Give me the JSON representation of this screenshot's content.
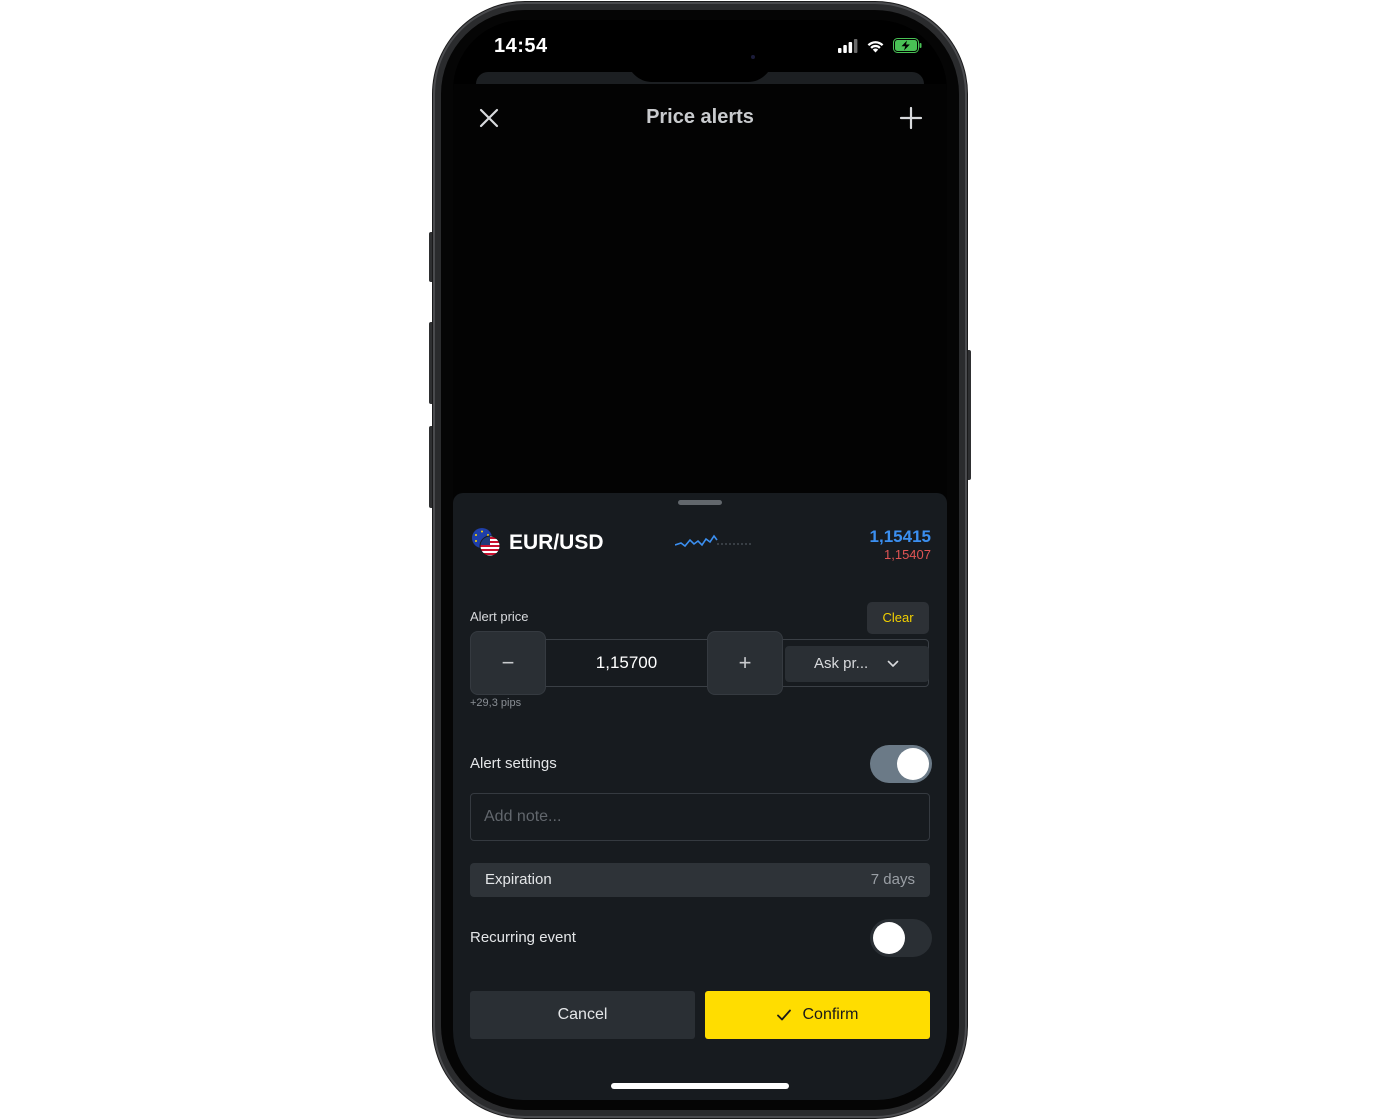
{
  "status_bar": {
    "time": "14:54",
    "icons": [
      "cellular-signal-icon",
      "wifi-icon",
      "battery-charging-icon"
    ]
  },
  "header": {
    "title": "Price alerts",
    "close_icon": "close-icon",
    "add_icon": "plus-icon"
  },
  "instrument": {
    "symbol": "EUR/USD",
    "flag_icon": "eu-us-flag-icon",
    "ask_price": "1,15415",
    "bid_price": "1,15407",
    "sparkline_icon": "sparkline-icon"
  },
  "alert_price": {
    "label": "Alert price",
    "clear_label": "Clear",
    "value": "1,15700",
    "decrement_label": "−",
    "increment_label": "+",
    "price_type": "Ask pr...",
    "pips": "+29,3 pips"
  },
  "alert_settings": {
    "label": "Alert settings",
    "enabled": true,
    "note_placeholder": "Add note...",
    "expiration_label": "Expiration",
    "expiration_value": "7 days",
    "recurring_label": "Recurring event",
    "recurring_enabled": false
  },
  "actions": {
    "cancel_label": "Cancel",
    "confirm_label": "Confirm"
  },
  "colors": {
    "accent_yellow": "#ffdd00",
    "ask_blue": "#3b8ff0",
    "bid_red": "#e05454",
    "sheet_bg": "#171b1f"
  }
}
